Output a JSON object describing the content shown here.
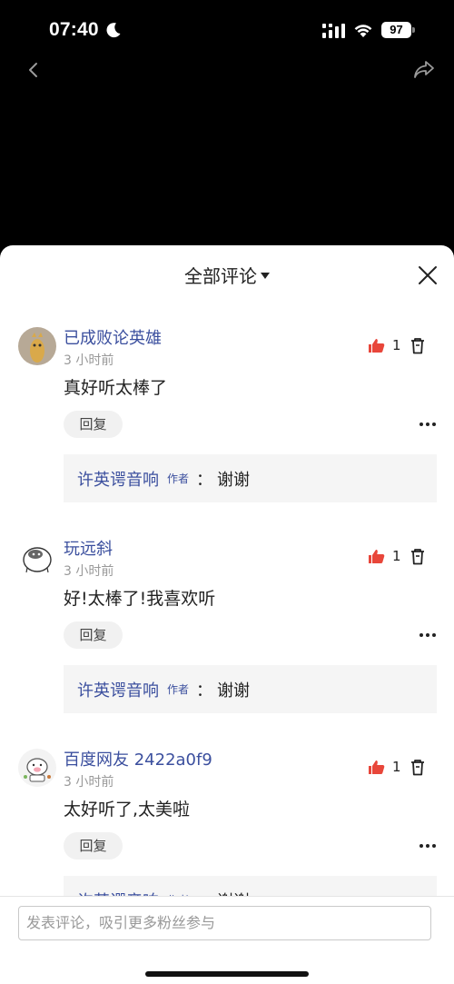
{
  "status_bar": {
    "time": "07:40",
    "battery": "97"
  },
  "sheet": {
    "title": "全部评论"
  },
  "comments": [
    {
      "username": "已成败论英雄",
      "time_ago": "3 小时前",
      "content": "真好听太棒了",
      "likes": "1",
      "reply_button": "回复",
      "reply": {
        "author": "许英谔音响",
        "badge": "作者",
        "colon": "：",
        "text": "谢谢"
      }
    },
    {
      "username": "玩远斜",
      "time_ago": "3 小时前",
      "content": "好!太棒了!我喜欢听",
      "likes": "1",
      "reply_button": "回复",
      "reply": {
        "author": "许英谔音响",
        "badge": "作者",
        "colon": "：",
        "text": "谢谢"
      }
    },
    {
      "username": "百度网友 2422a0f9",
      "time_ago": "3 小时前",
      "content": "太好听了,太美啦",
      "likes": "1",
      "reply_button": "回复",
      "reply": {
        "author": "许英谔音响",
        "badge": "作者",
        "colon": "：",
        "text": "谢谢"
      }
    }
  ],
  "input": {
    "placeholder": "发表评论，吸引更多粉丝参与"
  },
  "colors": {
    "link": "#3b4f9e",
    "like": "#e8463a"
  }
}
